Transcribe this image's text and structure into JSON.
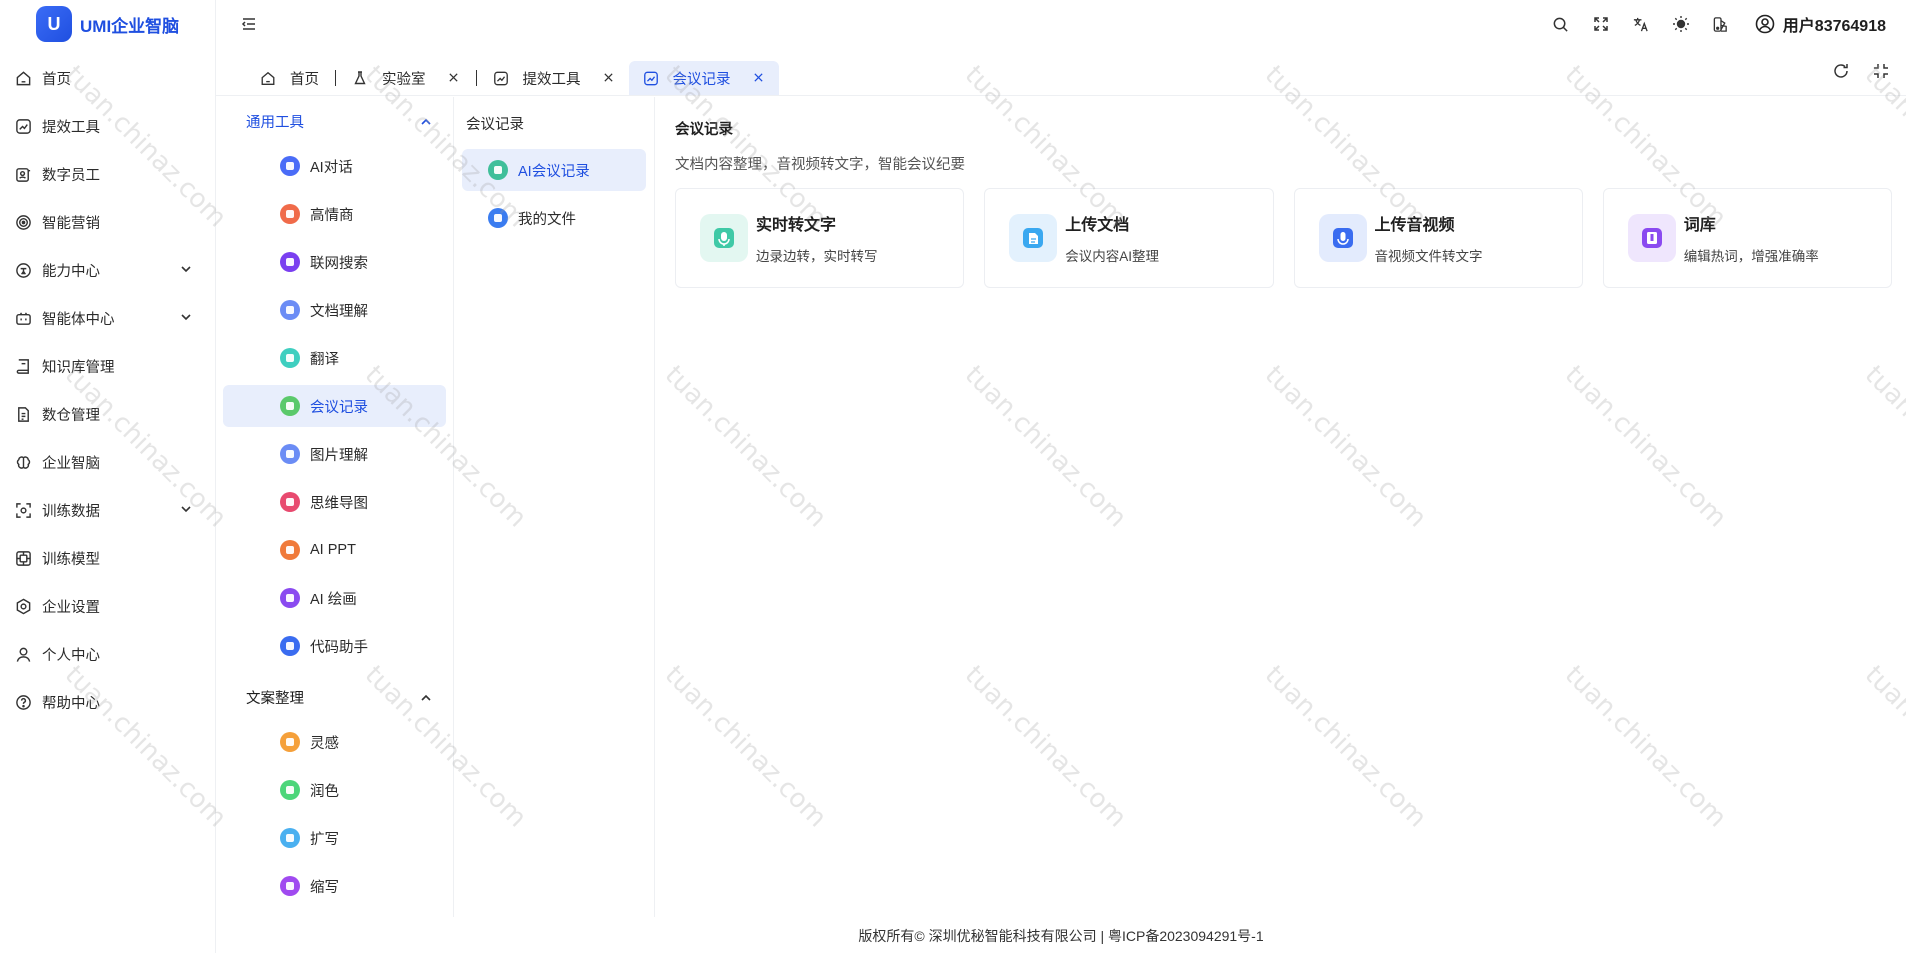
{
  "app": {
    "logo_text": "UMI企业智脑",
    "logo_glyph": "U"
  },
  "sidebar": {
    "items": [
      {
        "label": "首页",
        "icon": "home-icon",
        "has_chevron": false
      },
      {
        "label": "提效工具",
        "icon": "trend-icon",
        "has_chevron": false
      },
      {
        "label": "数字员工",
        "icon": "employee-card-icon",
        "has_chevron": false
      },
      {
        "label": "智能营销",
        "icon": "target-icon",
        "has_chevron": false
      },
      {
        "label": "能力中心",
        "icon": "ability-icon",
        "has_chevron": true
      },
      {
        "label": "智能体中心",
        "icon": "robot-icon",
        "has_chevron": true
      },
      {
        "label": "知识库管理",
        "icon": "book-icon",
        "has_chevron": false
      },
      {
        "label": "数仓管理",
        "icon": "document-icon",
        "has_chevron": false
      },
      {
        "label": "企业智脑",
        "icon": "brain-icon",
        "has_chevron": false
      },
      {
        "label": "训练数据",
        "icon": "scan-icon",
        "has_chevron": true
      },
      {
        "label": "训练模型",
        "icon": "model-icon",
        "has_chevron": false
      },
      {
        "label": "企业设置",
        "icon": "settings-icon",
        "has_chevron": false
      },
      {
        "label": "个人中心",
        "icon": "user-icon",
        "has_chevron": false
      },
      {
        "label": "帮助中心",
        "icon": "help-icon",
        "has_chevron": false
      }
    ]
  },
  "header": {
    "user_label": "用户83764918"
  },
  "tabs": [
    {
      "label": "首页",
      "icon": "home-icon",
      "closable": false,
      "active": false
    },
    {
      "label": "实验室",
      "icon": "flask-icon",
      "closable": true,
      "active": false
    },
    {
      "label": "提效工具",
      "icon": "trend-icon",
      "closable": true,
      "active": false
    },
    {
      "label": "会议记录",
      "icon": "trend-icon",
      "closable": true,
      "active": true
    }
  ],
  "categories": {
    "group1": {
      "label": "通用工具",
      "items": [
        {
          "label": "AI对话",
          "color": "#4a6cf7"
        },
        {
          "label": "高情商",
          "color": "#f06b4a"
        },
        {
          "label": "联网搜索",
          "color": "#7a3ff0"
        },
        {
          "label": "文档理解",
          "color": "#6b8cf5"
        },
        {
          "label": "翻译",
          "color": "#3fcfc0"
        },
        {
          "label": "会议记录",
          "color": "#5bc96b"
        },
        {
          "label": "图片理解",
          "color": "#6b8cf5"
        },
        {
          "label": "思维导图",
          "color": "#e84a6f"
        },
        {
          "label": "AI PPT",
          "color": "#f07a3a"
        },
        {
          "label": "AI 绘画",
          "color": "#8a4af0"
        },
        {
          "label": "代码助手",
          "color": "#3a6cf0"
        }
      ]
    },
    "group2": {
      "label": "文案整理",
      "items": [
        {
          "label": "灵感",
          "color": "#f5a03a"
        },
        {
          "label": "润色",
          "color": "#4cd67a"
        },
        {
          "label": "扩写",
          "color": "#4ab0f0"
        },
        {
          "label": "缩写",
          "color": "#a04af0"
        }
      ]
    }
  },
  "sub_panel": {
    "title": "会议记录",
    "items": [
      {
        "label": "AI会议记录",
        "color": "#3fbf9a"
      },
      {
        "label": "我的文件",
        "color": "#3a7cf0"
      }
    ]
  },
  "main": {
    "title": "会议记录",
    "description": "文档内容整理，音视频转文字，智能会议纪要",
    "cards": [
      {
        "title": "实时转文字",
        "subtitle": "边录边转，实时转写",
        "icon": "microphone-text-icon",
        "color": "#3fc9a6",
        "bg": "#e3f7f1"
      },
      {
        "title": "上传文档",
        "subtitle": "会议内容AI整理",
        "icon": "upload-document-icon",
        "color": "#3aa8f0",
        "bg": "#e3f1fd"
      },
      {
        "title": "上传音视频",
        "subtitle": "音视频文件转文字",
        "icon": "upload-audio-icon",
        "color": "#3a6cf0",
        "bg": "#e3ebfd"
      },
      {
        "title": "词库",
        "subtitle": "编辑热词，增强准确率",
        "icon": "lexicon-icon",
        "color": "#8a4af0",
        "bg": "#efe6fd"
      }
    ]
  },
  "footer": {
    "text": "版权所有© 深圳优秘智能科技有限公司 | 粤ICP备2023094291号-1"
  },
  "watermark": {
    "text": "tuan.chinaz.com"
  }
}
